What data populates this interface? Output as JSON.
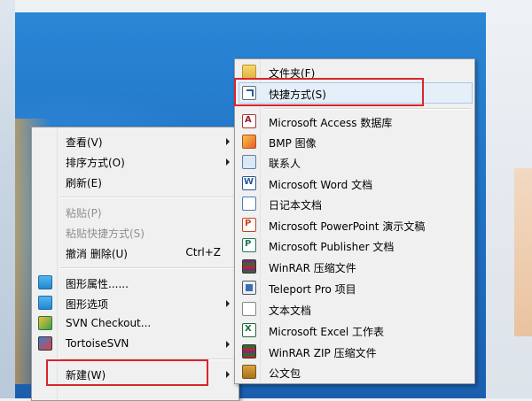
{
  "context_menu": {
    "items": [
      {
        "label": "查看(V)",
        "submenu": true
      },
      {
        "label": "排序方式(O)",
        "submenu": true
      },
      {
        "label": "刷新(E)"
      },
      {
        "label": "粘贴(P)",
        "disabled": true
      },
      {
        "label": "粘贴快捷方式(S)",
        "disabled": true
      },
      {
        "label": "撤消 删除(U)",
        "shortcut": "Ctrl+Z"
      },
      {
        "label": "图形属性......",
        "icon": "graphics-properties-icon"
      },
      {
        "label": "图形选项",
        "icon": "graphics-options-icon",
        "submenu": true
      },
      {
        "label": "SVN Checkout...",
        "icon": "svn-checkout-icon"
      },
      {
        "label": "TortoiseSVN",
        "icon": "tortoisesvn-icon",
        "submenu": true
      },
      {
        "label": "新建(W)",
        "submenu": true,
        "highlighted": true
      }
    ]
  },
  "new_submenu": {
    "items": [
      {
        "label": "文件夹(F)",
        "icon": "folder-icon"
      },
      {
        "label": "快捷方式(S)",
        "icon": "shortcut-icon",
        "highlighted": true
      },
      {
        "label": "Microsoft Access 数据库",
        "icon": "access-icon"
      },
      {
        "label": "BMP 图像",
        "icon": "bmp-icon"
      },
      {
        "label": "联系人",
        "icon": "contact-icon"
      },
      {
        "label": "Microsoft Word 文档",
        "icon": "word-icon"
      },
      {
        "label": "日记本文档",
        "icon": "journal-icon"
      },
      {
        "label": "Microsoft PowerPoint 演示文稿",
        "icon": "powerpoint-icon"
      },
      {
        "label": "Microsoft Publisher 文档",
        "icon": "publisher-icon"
      },
      {
        "label": "WinRAR 压缩文件",
        "icon": "winrar-icon"
      },
      {
        "label": "Teleport Pro 项目",
        "icon": "teleport-icon"
      },
      {
        "label": "文本文档",
        "icon": "text-document-icon"
      },
      {
        "label": "Microsoft Excel 工作表",
        "icon": "excel-icon"
      },
      {
        "label": "WinRAR ZIP 压缩文件",
        "icon": "winrar-zip-icon"
      },
      {
        "label": "公文包",
        "icon": "briefcase-icon"
      }
    ]
  },
  "colors": {
    "highlight_border": "#d8262a",
    "desktop_blue": "#1f6fc2",
    "menu_bg": "#f0f0f0"
  }
}
